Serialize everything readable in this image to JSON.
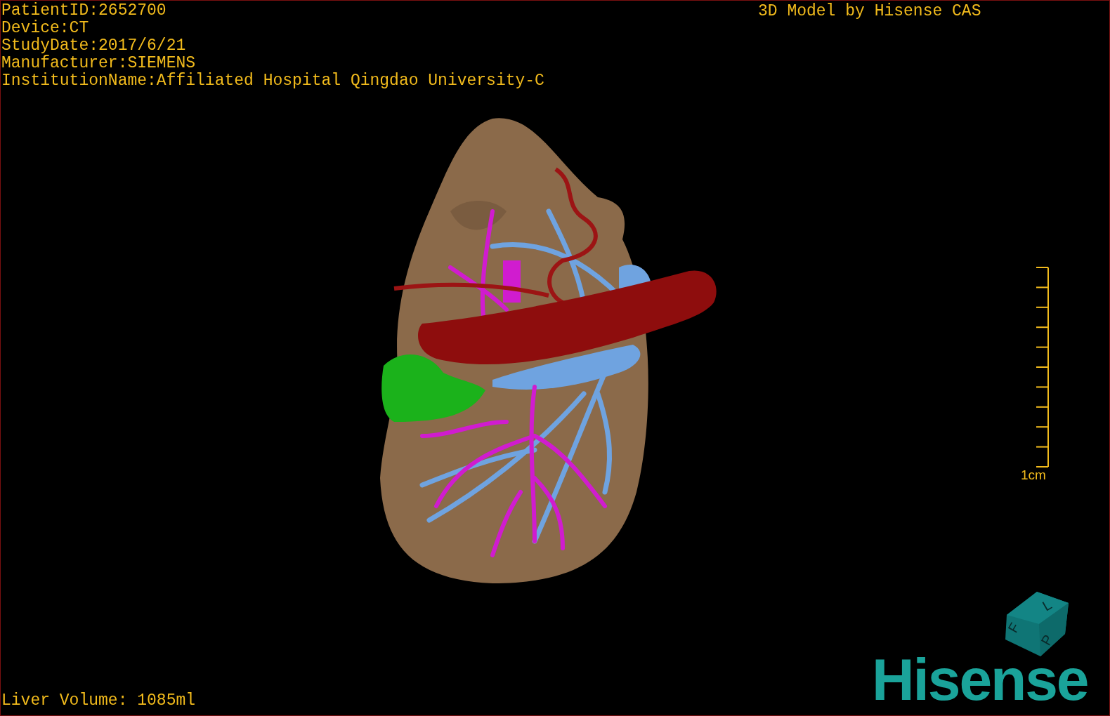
{
  "info_lines": [
    "PatientID:2652700",
    "Device:CT",
    "StudyDate:2017/6/21",
    "Manufacturer:SIEMENS",
    "InstitutionName:Affiliated Hospital Qingdao University-C"
  ],
  "model_credit": "3D Model by Hisense CAS",
  "scale_bar": {
    "label": "1cm"
  },
  "orientation_cube": {
    "faces": [
      "F",
      "L",
      "P"
    ]
  },
  "volume": "Liver Volume: 1085ml",
  "logo": "Hisense"
}
